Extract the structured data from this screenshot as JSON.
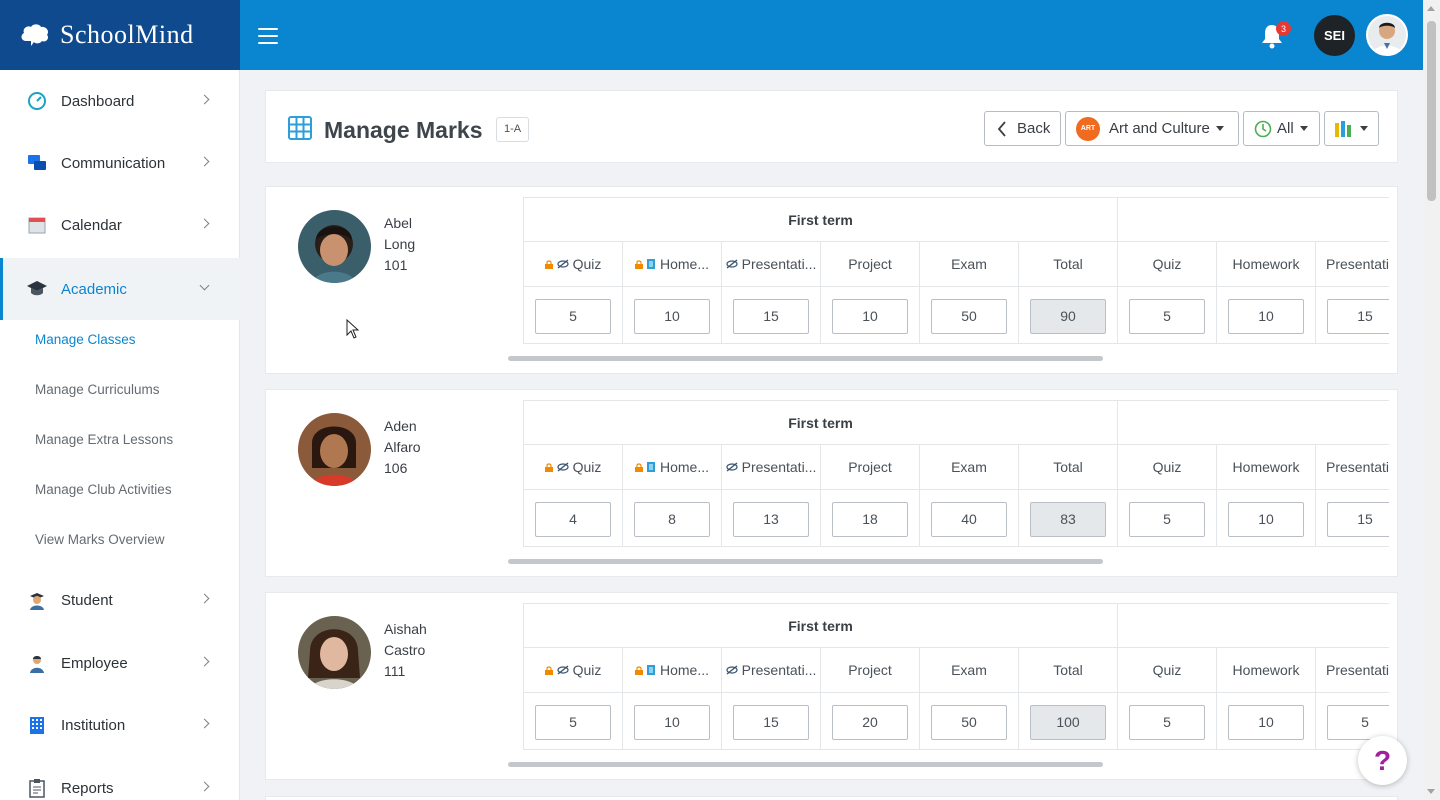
{
  "app": {
    "logo_text": "SchoolMind",
    "user_initials": "SEI",
    "notification_count": "3"
  },
  "sidebar": {
    "items": [
      {
        "label": "Dashboard",
        "icon": "dashboard-gauge-icon"
      },
      {
        "label": "Communication",
        "icon": "chat-bubbles-icon"
      },
      {
        "label": "Calendar",
        "icon": "calendar-icon"
      },
      {
        "label": "Academic",
        "icon": "graduation-cap-icon",
        "expanded": true
      },
      {
        "label": "Student",
        "icon": "student-icon"
      },
      {
        "label": "Employee",
        "icon": "employee-icon"
      },
      {
        "label": "Institution",
        "icon": "building-icon"
      },
      {
        "label": "Reports",
        "icon": "clipboard-icon"
      }
    ],
    "academic_sub": [
      "Manage Classes",
      "Manage Curriculums",
      "Manage Extra Lessons",
      "Manage Club Activities",
      "View Marks Overview"
    ],
    "active_sub": "Manage Classes"
  },
  "header": {
    "title": "Manage Marks",
    "class_badge": "1-A",
    "back_label": "Back",
    "subject_badge": "ART",
    "subject_label": "Art and Culture",
    "filter_label": "All"
  },
  "marks": {
    "term_label": "First term",
    "columns": [
      "Quiz",
      "Home...",
      "Presentati...",
      "Project",
      "Exam",
      "Total",
      "Quiz",
      "Homework",
      "Presentati"
    ],
    "students": [
      {
        "first": "Abel",
        "last": "Long",
        "id": "101",
        "values": [
          "5",
          "10",
          "15",
          "10",
          "50",
          "90",
          "5",
          "10",
          "15"
        ]
      },
      {
        "first": "Aden",
        "last": "Alfaro",
        "id": "106",
        "values": [
          "4",
          "8",
          "13",
          "18",
          "40",
          "83",
          "5",
          "10",
          "15"
        ]
      },
      {
        "first": "Aishah",
        "last": "Castro",
        "id": "111",
        "values": [
          "5",
          "10",
          "15",
          "20",
          "50",
          "100",
          "5",
          "10",
          "5"
        ]
      }
    ]
  },
  "help": {
    "label": "?"
  },
  "colors": {
    "topbar": "#0a86d0",
    "logo_bg": "#0f4a8f",
    "accent": "#0a86d0",
    "art_badge": "#f06a1f"
  }
}
